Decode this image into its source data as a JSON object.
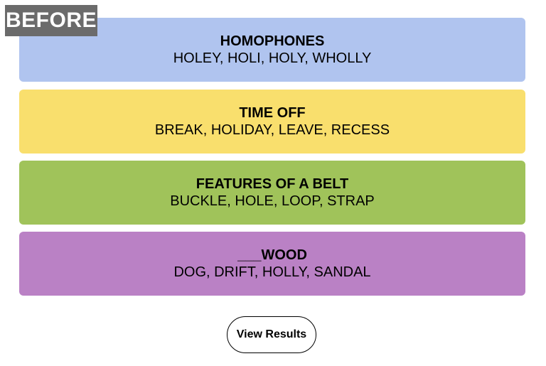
{
  "badge": "BEFORE",
  "groups": [
    {
      "title": "HOMOPHONES",
      "words": "HOLEY, HOLI, HOLY, WHOLLY",
      "color": "#b0c4ef"
    },
    {
      "title": "TIME OFF",
      "words": "BREAK, HOLIDAY, LEAVE, RECESS",
      "color": "#f9df6d"
    },
    {
      "title": "FEATURES OF A BELT",
      "words": "BUCKLE, HOLE, LOOP, STRAP",
      "color": "#a0c35a"
    },
    {
      "title": "___WOOD",
      "words": "DOG, DRIFT, HOLLY, SANDAL",
      "color": "#ba81c5"
    }
  ],
  "view_results_label": "View Results"
}
